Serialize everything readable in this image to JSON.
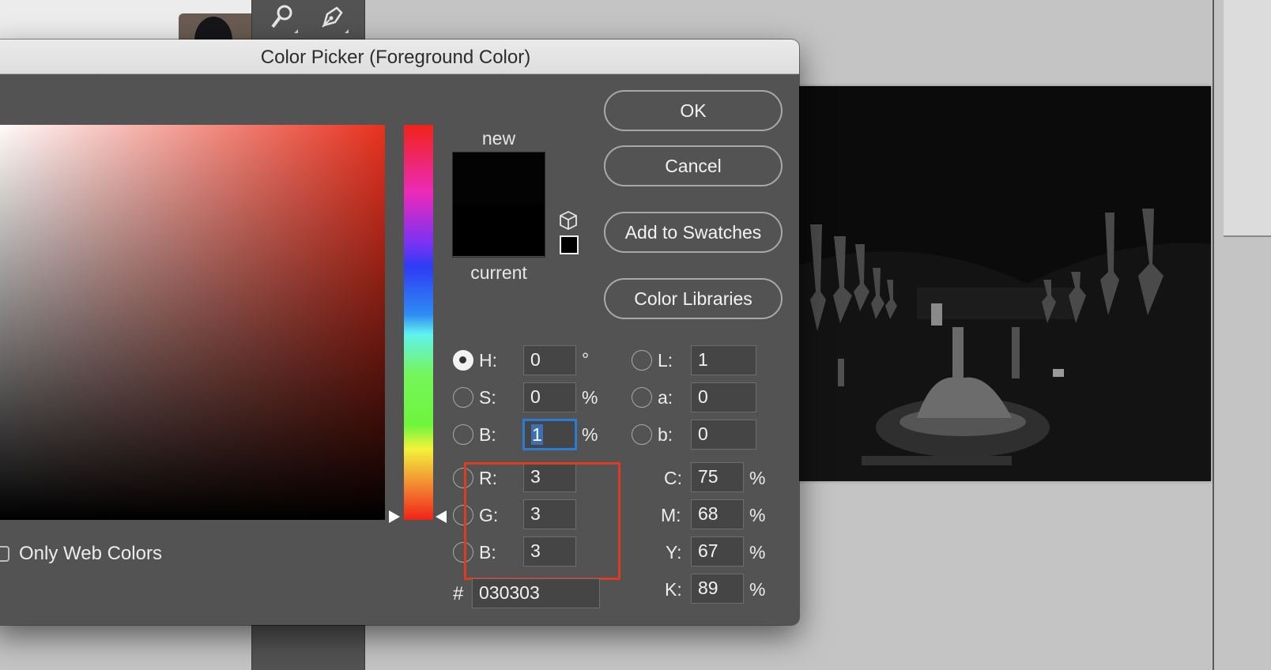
{
  "dialog": {
    "title": "Color Picker (Foreground Color)",
    "buttons": {
      "ok": "OK",
      "cancel": "Cancel",
      "add_to_swatches": "Add to Swatches",
      "color_libraries": "Color Libraries"
    },
    "preview": {
      "new_label": "new",
      "current_label": "current",
      "new_color": "#030303",
      "current_color": "#000000"
    },
    "only_web_colors_label": "Only Web Colors",
    "only_web_colors_checked": false,
    "selected_mode": "H",
    "hsb": {
      "h_label": "H:",
      "h_value": "0",
      "h_unit": "°",
      "s_label": "S:",
      "s_value": "0",
      "s_unit": "%",
      "b_label": "B:",
      "b_value": "1",
      "b_unit": "%"
    },
    "rgb": {
      "r_label": "R:",
      "r_value": "3",
      "g_label": "G:",
      "g_value": "3",
      "b_label": "B:",
      "b_value": "3"
    },
    "lab": {
      "l_label": "L:",
      "l_value": "1",
      "a_label": "a:",
      "a_value": "0",
      "b_label": "b:",
      "b_value": "0"
    },
    "cmyk": {
      "c_label": "C:",
      "c_value": "75",
      "c_unit": "%",
      "m_label": "M:",
      "m_value": "68",
      "m_unit": "%",
      "y_label": "Y:",
      "y_value": "67",
      "y_unit": "%",
      "k_label": "K:",
      "k_value": "89",
      "k_unit": "%"
    },
    "hex": {
      "label": "#",
      "value": "030303"
    },
    "hue_color": "#e8311e",
    "annotation_color": "#e03a22"
  },
  "toolbar": {
    "icons": [
      "quick-selection-icon",
      "pen-icon"
    ]
  }
}
